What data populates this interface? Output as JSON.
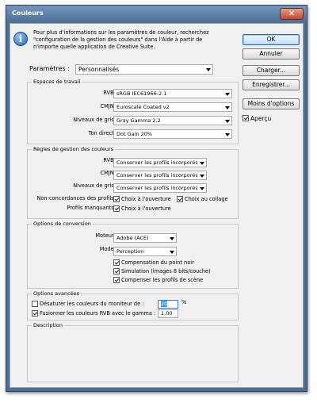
{
  "window": {
    "title": "Couleurs",
    "close_label": "✕"
  },
  "info": {
    "icon_glyph": "i",
    "lines": [
      "Pour plus d'informations sur les paramètres de couleur, recherchez",
      "\"configuration de la gestion des couleurs\" dans l'Aide à partir de",
      "n'importe quelle application de Creative Suite."
    ]
  },
  "settings": {
    "label": "Paramètres :",
    "value": "Personnalisés"
  },
  "working_spaces": {
    "title": "Espaces de travail",
    "rows": [
      {
        "label": "RVB :",
        "value": "sRGB IEC61966-2.1"
      },
      {
        "label": "CMJN :",
        "value": "Euroscale Coated v2"
      },
      {
        "label": "Niveaux de gris :",
        "value": "Gray Gamma 2.2"
      },
      {
        "label": "Ton direct :",
        "value": "Dot Gain 20%"
      }
    ]
  },
  "policies": {
    "title": "Règles de gestion des couleurs",
    "rows": [
      {
        "label": "RVB :",
        "value": "Conserver les profils incorporés"
      },
      {
        "label": "CMJN :",
        "value": "Conserver les profils incorporés"
      },
      {
        "label": "Niveaux de gris :",
        "value": "Conserver les profils incorporés"
      }
    ],
    "mismatch_label": "Non-concordances des profils :",
    "mismatch_open": "Choix à l'ouverture",
    "mismatch_paste": "Choix au collage",
    "missing_label": "Profils manquants :",
    "missing_open": "Choix à l'ouverture"
  },
  "conversion": {
    "title": "Options de conversion",
    "engine_label": "Moteur :",
    "engine_value": "Adobe (ACE)",
    "mode_label": "Mode :",
    "mode_value": "Perception",
    "bpc": "Compensation du point noir",
    "dither": "Simulation (images 8 bits/couche)",
    "compensate": "Compenser les profils de scène"
  },
  "advanced": {
    "title": "Options avancées",
    "desaturate_label": "Désaturer les couleurs du moniteur de :",
    "desaturate_value": "20",
    "desaturate_unit": "%",
    "blend_label": "Fusionner les couleurs RVB avec le gamma :",
    "blend_value": "1,00"
  },
  "description": {
    "title": "Description"
  },
  "buttons": {
    "ok": "OK",
    "cancel": "Annuler",
    "load": "Charger...",
    "save": "Enregistrer...",
    "fewer": "Moins d'options",
    "preview": "Aperçu"
  }
}
